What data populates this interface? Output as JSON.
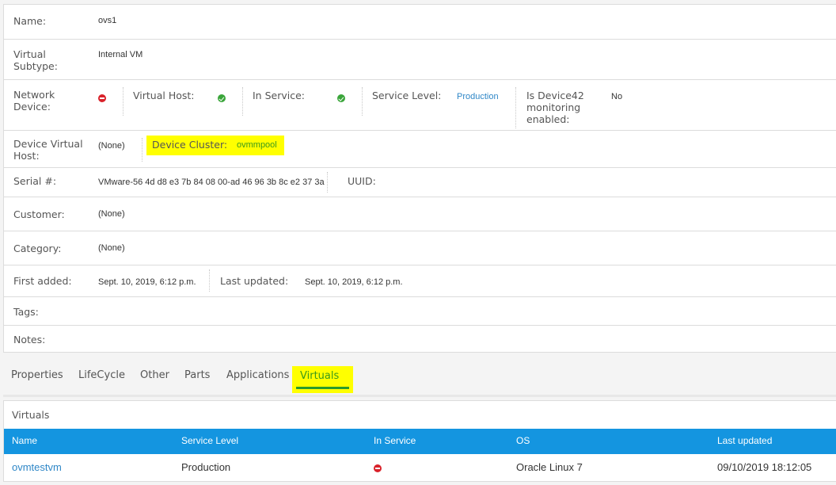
{
  "fields": {
    "name": {
      "label": "Name:",
      "value": "ovs1"
    },
    "virtual_subtype": {
      "label": "Virtual Subtype:",
      "label_l1": "Virtual",
      "label_l2": "Subtype:",
      "value": "Internal VM"
    },
    "network_device": {
      "label_l1": "Network",
      "label_l2": "Device:",
      "icon": "no-icon",
      "value": false
    },
    "virtual_host": {
      "label": "Virtual Host:",
      "icon": "yes-icon",
      "value": true
    },
    "in_service": {
      "label": "In Service:",
      "icon": "yes-icon",
      "value": true
    },
    "service_level": {
      "label": "Service Level:",
      "value": "Production"
    },
    "d42_monitoring": {
      "label_l1": "Is Device42",
      "label_l2": "monitoring",
      "label_l3": "enabled:",
      "value": "No"
    },
    "device_virtual_host": {
      "label_l1": "Device Virtual",
      "label_l2": "Host:",
      "value": "(None)"
    },
    "device_cluster": {
      "label": "Device Cluster:",
      "value": "ovmmpool",
      "highlight_color": "#ffff00"
    },
    "serial": {
      "label": "Serial #:",
      "value": "VMware-56 4d d8 e3 7b 84 08 00-ad 46 96 3b 8c e2 37 3a"
    },
    "uuid": {
      "label": "UUID:",
      "value": ""
    },
    "customer": {
      "label": "Customer:",
      "value": "(None)"
    },
    "category": {
      "label": "Category:",
      "value": "(None)"
    },
    "first_added": {
      "label": "First added:",
      "value": "Sept. 10, 2019, 6:12 p.m."
    },
    "last_updated": {
      "label": "Last updated:",
      "value": "Sept. 10, 2019, 6:12 p.m."
    },
    "tags": {
      "label": "Tags:",
      "value": ""
    },
    "notes": {
      "label": "Notes:",
      "value": ""
    }
  },
  "tabs": [
    {
      "label": "Properties",
      "active": false
    },
    {
      "label": "LifeCycle",
      "active": false
    },
    {
      "label": "Other",
      "active": false
    },
    {
      "label": "Parts",
      "active": false
    },
    {
      "label": "Applications",
      "active": false
    },
    {
      "label": "Virtuals",
      "active": true
    }
  ],
  "virtuals": {
    "title": "Virtuals",
    "header_color": "#1495e0",
    "columns": [
      "Name",
      "Service Level",
      "In Service",
      "OS",
      "Last updated"
    ],
    "rows": [
      {
        "name": "ovmtestvm",
        "service_level": "Production",
        "in_service": "no-icon",
        "os": "Oracle Linux 7",
        "last_updated": "09/10/2019 18:12:05"
      }
    ]
  },
  "colors": {
    "link": "#2f87c7",
    "active_tab": "#2a9b2a",
    "highlight": "#ffff00",
    "status_no": "#d9222a",
    "status_yes": "#3aa53a"
  }
}
